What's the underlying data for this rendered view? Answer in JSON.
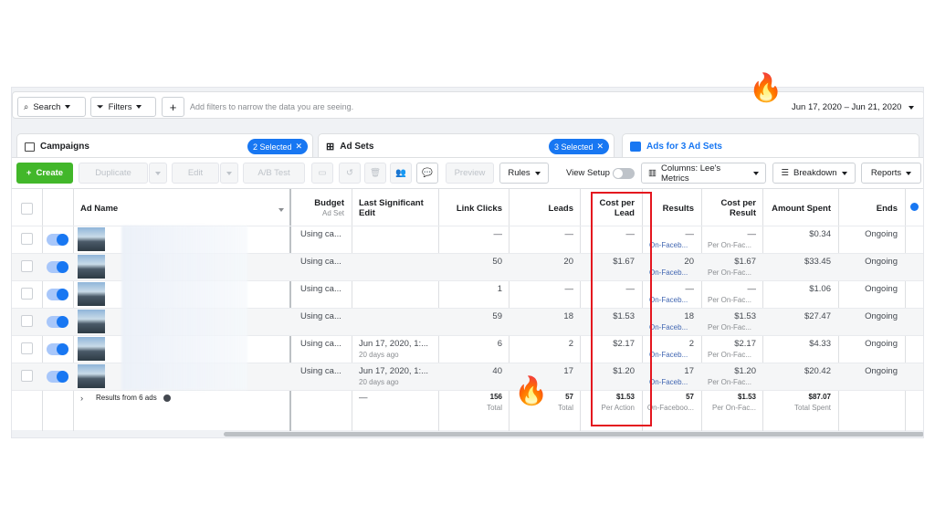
{
  "filterbar": {
    "search_label": "Search",
    "filters_label": "Filters",
    "add_label": "+",
    "hint": "Add filters to narrow the data you are seeing.",
    "date_range": "Jun 17, 2020 – Jun 21, 2020"
  },
  "tabs": {
    "campaigns": {
      "label": "Campaigns",
      "pill": "2 Selected"
    },
    "adsets": {
      "label": "Ad Sets",
      "pill": "3 Selected"
    },
    "ads": {
      "label": "Ads for 3 Ad Sets"
    }
  },
  "toolbar": {
    "create": "Create",
    "duplicate": "Duplicate",
    "edit": "Edit",
    "ab_test": "A/B Test",
    "preview": "Preview",
    "rules": "Rules",
    "view_setup": "View Setup",
    "columns": "Columns: Lee's Metrics",
    "breakdown": "Breakdown",
    "reports": "Reports"
  },
  "table": {
    "headers": {
      "ad_name": "Ad Name",
      "budget": "Budget",
      "budget_sub": "Ad Set",
      "last_edit_1": "Last Significant",
      "last_edit_2": "Edit",
      "link_clicks": "Link Clicks",
      "leads": "Leads",
      "cpl_1": "Cost per",
      "cpl_2": "Lead",
      "results": "Results",
      "cpr_1": "Cost per",
      "cpr_2": "Result",
      "amount_spent": "Amount Spent",
      "ends": "Ends"
    },
    "rows": [
      {
        "budget": "Using ca...",
        "edit": "",
        "edit_sub": "",
        "clicks": "—",
        "leads": "—",
        "cpl": "—",
        "results": "—",
        "results_sub": "On-Faceb...",
        "cpr": "—",
        "cpr_sub": "Per On-Fac...",
        "spent": "$0.34",
        "ends": "Ongoing"
      },
      {
        "budget": "Using ca...",
        "edit": "",
        "edit_sub": "",
        "clicks": "50",
        "leads": "20",
        "cpl": "$1.67",
        "results": "20",
        "results_sub": "On-Faceb...",
        "cpr": "$1.67",
        "cpr_sub": "Per On-Fac...",
        "spent": "$33.45",
        "ends": "Ongoing"
      },
      {
        "budget": "Using ca...",
        "edit": "",
        "edit_sub": "",
        "clicks": "1",
        "leads": "—",
        "cpl": "—",
        "results": "—",
        "results_sub": "On-Faceb...",
        "cpr": "—",
        "cpr_sub": "Per On-Fac...",
        "spent": "$1.06",
        "ends": "Ongoing"
      },
      {
        "budget": "Using ca...",
        "edit": "",
        "edit_sub": "",
        "clicks": "59",
        "leads": "18",
        "cpl": "$1.53",
        "results": "18",
        "results_sub": "On-Faceb...",
        "cpr": "$1.53",
        "cpr_sub": "Per On-Fac...",
        "spent": "$27.47",
        "ends": "Ongoing"
      },
      {
        "budget": "Using ca...",
        "edit": "Jun 17, 2020, 1:...",
        "edit_sub": "20 days ago",
        "clicks": "6",
        "leads": "2",
        "cpl": "$2.17",
        "results": "2",
        "results_sub": "On-Faceb...",
        "cpr": "$2.17",
        "cpr_sub": "Per On-Fac...",
        "spent": "$4.33",
        "ends": "Ongoing"
      },
      {
        "budget": "Using ca...",
        "edit": "Jun 17, 2020, 1:...",
        "edit_sub": "20 days ago",
        "clicks": "40",
        "leads": "17",
        "cpl": "$1.20",
        "results": "17",
        "results_sub": "On-Faceb...",
        "cpr": "$1.20",
        "cpr_sub": "Per On-Fac...",
        "spent": "$20.42",
        "ends": "Ongoing"
      }
    ],
    "summary": {
      "label": "Results from 6 ads",
      "edit": "—",
      "clicks": "156",
      "clicks_sub": "Total",
      "leads": "57",
      "leads_sub": "Total",
      "cpl": "$1.53",
      "cpl_sub": "Per Action",
      "results": "57",
      "results_sub": "On-Faceboo...",
      "cpr": "$1.53",
      "cpr_sub": "Per On-Fac...",
      "spent": "$87.07",
      "spent_sub": "Total Spent"
    }
  },
  "colors": {
    "accent": "#1877f2",
    "create": "#42b72a",
    "highlight": "#e4161f"
  },
  "icons": [
    "search-icon",
    "filter-icon",
    "caret-down-icon",
    "campaign-icon",
    "adset-icon",
    "ad-icon",
    "fire-emoji",
    "info-icon",
    "plus-icon"
  ]
}
